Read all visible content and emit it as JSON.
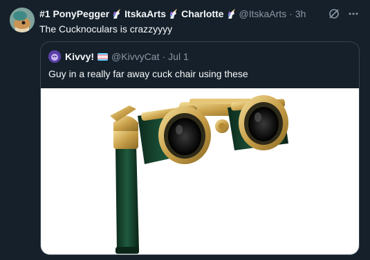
{
  "tweet": {
    "display_name": "#1 PonyPegger",
    "name_part2": "ItskaArts",
    "name_part3": "Charlotte",
    "handle": "@ItskaArts",
    "separator": "·",
    "time": "3h",
    "text": "The Cucknoculars is crazzyyyy",
    "name_emoji_icon": "unicorn-icon"
  },
  "quote": {
    "display_name": "Kivvy!",
    "flag_icon": "transgender-flag-icon",
    "handle": "@KivvyCat",
    "separator": "·",
    "time": "Jul 1",
    "text": "Guy in a really far away cuck chair using these",
    "media_subject": "opera-glasses-image"
  },
  "actions": {
    "grok_icon": "grok-icon",
    "more_icon": "more-icon"
  },
  "colors": {
    "background": "#15202b",
    "text": "#f7f9f9",
    "muted": "#8b98a5",
    "border": "#38444d"
  }
}
